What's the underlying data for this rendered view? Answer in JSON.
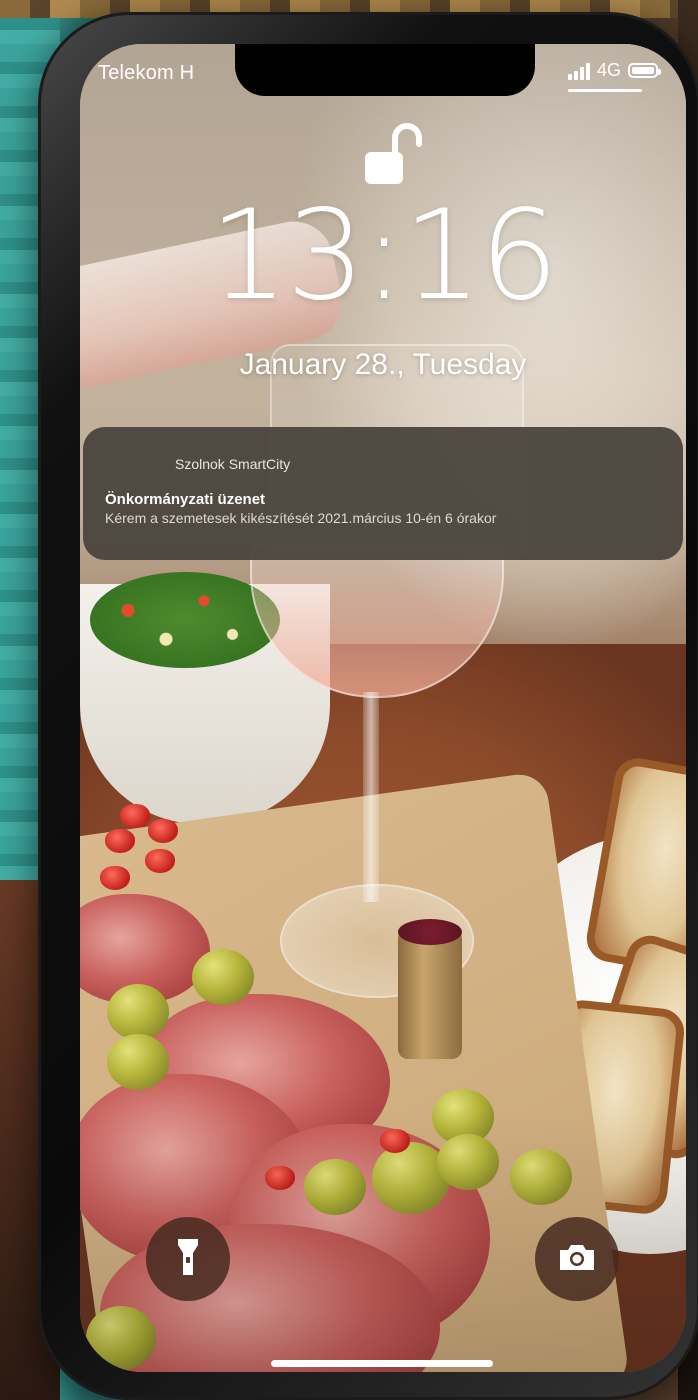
{
  "status_bar": {
    "carrier": "Telekom H",
    "network": "4G",
    "signal_bars": 4,
    "battery_level": 1.0
  },
  "lockscreen": {
    "lock_state": "unlocked",
    "time": "13:16",
    "date": "January 28., Tuesday"
  },
  "notification": {
    "app_name": "Szolnok SmartCity",
    "title": "Önkormányzati üzenet",
    "body": "Kérem a szemetesek kikészítését 2021.március 10-én 6 órakor"
  },
  "quick_actions": {
    "left_icon": "flashlight-icon",
    "right_icon": "camera-icon"
  },
  "colors": {
    "notification_bg": "#4c463e",
    "quick_action_bg": "#462a20",
    "text": "#ffffff"
  }
}
